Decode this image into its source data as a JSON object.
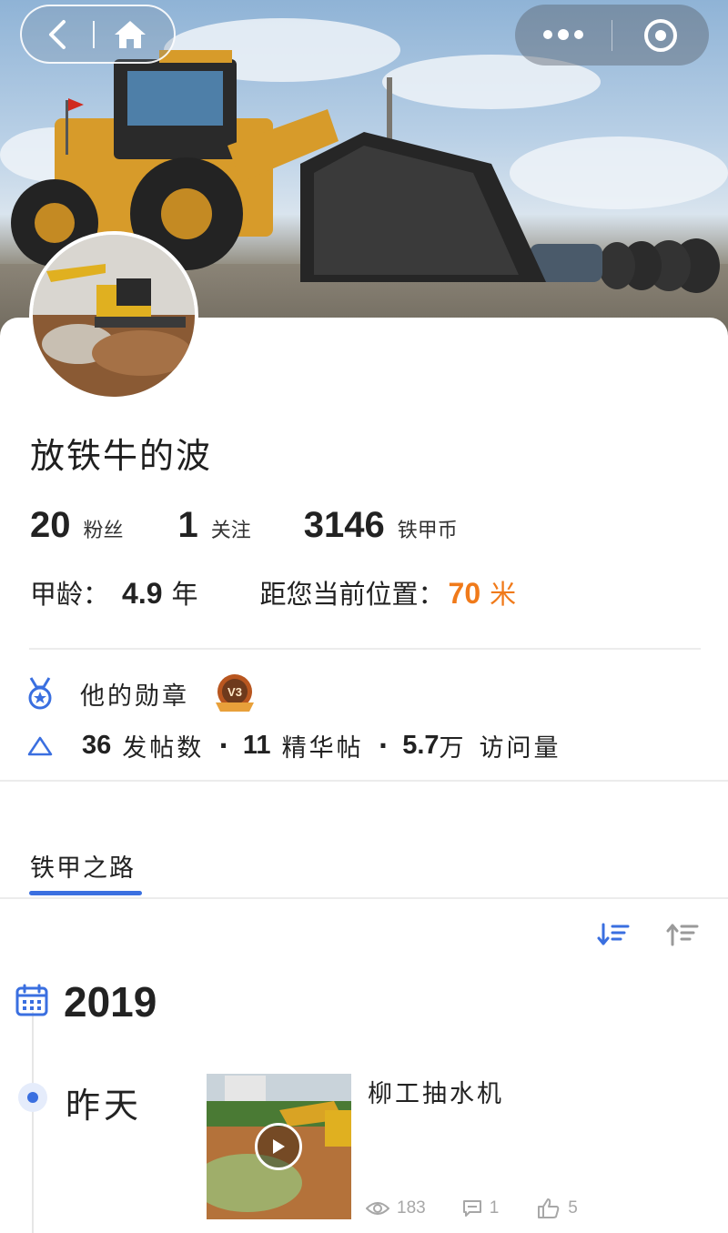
{
  "nav": {
    "back_icon": "chevron-left-icon",
    "home_icon": "home-icon",
    "more_icon": "more-dots-icon",
    "close_icon": "target-circle-icon"
  },
  "profile": {
    "name": "放铁牛的波",
    "stats": [
      {
        "value": "20",
        "label": "粉丝"
      },
      {
        "value": "1",
        "label": "关注"
      },
      {
        "value": "3146",
        "label": "铁甲币"
      }
    ],
    "age_label": "甲龄：",
    "age_value": "4.9",
    "age_unit": "年",
    "distance_label": "距您当前位置：",
    "distance_value": "70",
    "distance_unit": "米",
    "accent_color": "#f07a1a"
  },
  "medals": {
    "label": "他的勋章",
    "badge_text": "V3"
  },
  "activity": {
    "posts_count": "36",
    "posts_label": "发帖数",
    "featured_count": "11",
    "featured_label": "精华帖",
    "visits_count": "5.7",
    "visits_unit": "万",
    "visits_label": "访问量",
    "separator": "·"
  },
  "tabs": {
    "active": "铁甲之路",
    "accent_color": "#3a6fe0"
  },
  "timeline": {
    "year": "2019",
    "day": "昨天",
    "post": {
      "title": "柳工抽水机",
      "views": "183",
      "comments": "1",
      "likes": "5"
    }
  }
}
